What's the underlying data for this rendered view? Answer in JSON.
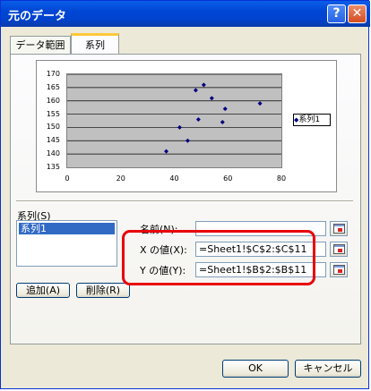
{
  "window": {
    "title": "元のデータ",
    "help_glyph": "?",
    "close_glyph": "✕"
  },
  "tabs": [
    {
      "label": "データ範囲",
      "selected": false
    },
    {
      "label": "系列",
      "selected": true
    }
  ],
  "chart_data": {
    "type": "scatter",
    "title": "",
    "xlabel": "",
    "ylabel": "",
    "xlim": [
      0,
      80
    ],
    "ylim": [
      135,
      170
    ],
    "x_ticks": [
      "0",
      "20",
      "40",
      "60",
      "80"
    ],
    "y_ticks": [
      "170",
      "165",
      "160",
      "155",
      "150",
      "145",
      "140",
      "135"
    ],
    "series": [
      {
        "name": "系列1",
        "marker": "diamond",
        "color": "#000080",
        "x": [
          37,
          42,
          45,
          48,
          49,
          51,
          54,
          58,
          59,
          72
        ],
        "y": [
          141,
          150,
          145,
          164,
          153,
          166,
          161,
          152,
          157,
          159
        ]
      }
    ],
    "legend": {
      "placement": "right",
      "entries": [
        "系列1"
      ],
      "marker_glyph": "◆"
    }
  },
  "series_section": {
    "label": "系列(S)",
    "items": [
      "系列1"
    ]
  },
  "name_field": {
    "label": "名前(N):",
    "value": ""
  },
  "x_field": {
    "label": "X の値(X):",
    "value": "=Sheet1!$C$2:$C$11"
  },
  "y_field": {
    "label": "Y の値(Y):",
    "value": "=Sheet1!$B$2:$B$11"
  },
  "buttons": {
    "add": "追加(A)",
    "remove": "削除(R)",
    "ok": "OK",
    "cancel": "キャンセル"
  },
  "colors": {
    "titlebar": "#0046d5",
    "highlight": "#e8000b",
    "selection": "#316ac5",
    "marker": "#000080",
    "plot_bg": "#c0c0c0"
  }
}
